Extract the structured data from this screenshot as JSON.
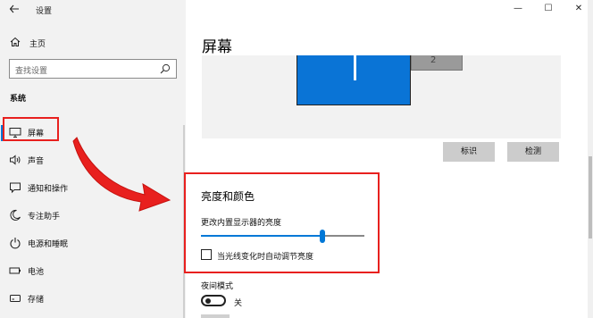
{
  "window": {
    "title": "设置",
    "back_icon": "arrow-left-icon",
    "minimize_glyph": "—",
    "maximize_glyph": "☐",
    "close_glyph": "✕"
  },
  "sidebar": {
    "home_label": "主页",
    "search_placeholder": "查找设置",
    "section_title": "系统",
    "items": [
      {
        "label": "屏幕",
        "icon": "monitor-icon",
        "active": true
      },
      {
        "label": "声音",
        "icon": "speaker-icon"
      },
      {
        "label": "通知和操作",
        "icon": "notification-icon"
      },
      {
        "label": "专注助手",
        "icon": "moon-icon"
      },
      {
        "label": "电源和睡眠",
        "icon": "power-icon"
      },
      {
        "label": "电池",
        "icon": "battery-icon"
      },
      {
        "label": "存储",
        "icon": "storage-icon"
      }
    ]
  },
  "main": {
    "page_title": "屏幕",
    "display": {
      "monitor_1_number": "1",
      "monitor_2_number": "2"
    },
    "identify_button": "标识",
    "detect_button": "检测",
    "brightness_section": {
      "heading": "亮度和颜色",
      "brightness_label": "更改内置显示器的亮度",
      "brightness_value": 0.75,
      "auto_brightness_label": "当光线变化时自动调节亮度",
      "auto_brightness_checked": false
    },
    "night_mode": {
      "label": "夜间模式",
      "toggle_state": "关",
      "on": false
    }
  },
  "colors": {
    "accent": "#0078d7",
    "highlight": "#e8201e",
    "sidebar_bg": "#f2f2f2"
  }
}
